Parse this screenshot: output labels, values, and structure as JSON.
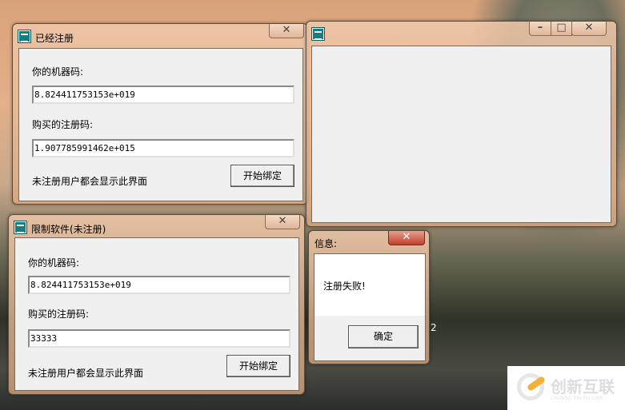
{
  "windows": {
    "registered": {
      "title": "已经注册",
      "machine_label": "你的机器码:",
      "machine_value": "8.824411753153e+019",
      "code_label": "购买的注册码:",
      "code_value": "1.907785991462e+015",
      "note": "未注册用户都会显示此界面",
      "bind_button": "开始绑定"
    },
    "limited": {
      "title": "限制软件(未注册)",
      "machine_label": "你的机器码:",
      "machine_value": "8.824411753153e+019",
      "code_label": "购买的注册码:",
      "code_value": "33333",
      "note": "未注册用户都会显示此界面",
      "bind_button": "开始绑定"
    },
    "blank": {
      "title": ""
    },
    "message": {
      "title": "信息:",
      "text": "注册失败!",
      "ok_button": "确定"
    }
  },
  "stray_text": "2",
  "watermark": {
    "text": "创新互联",
    "sub": "CHUANG XIN HU LIAN"
  }
}
